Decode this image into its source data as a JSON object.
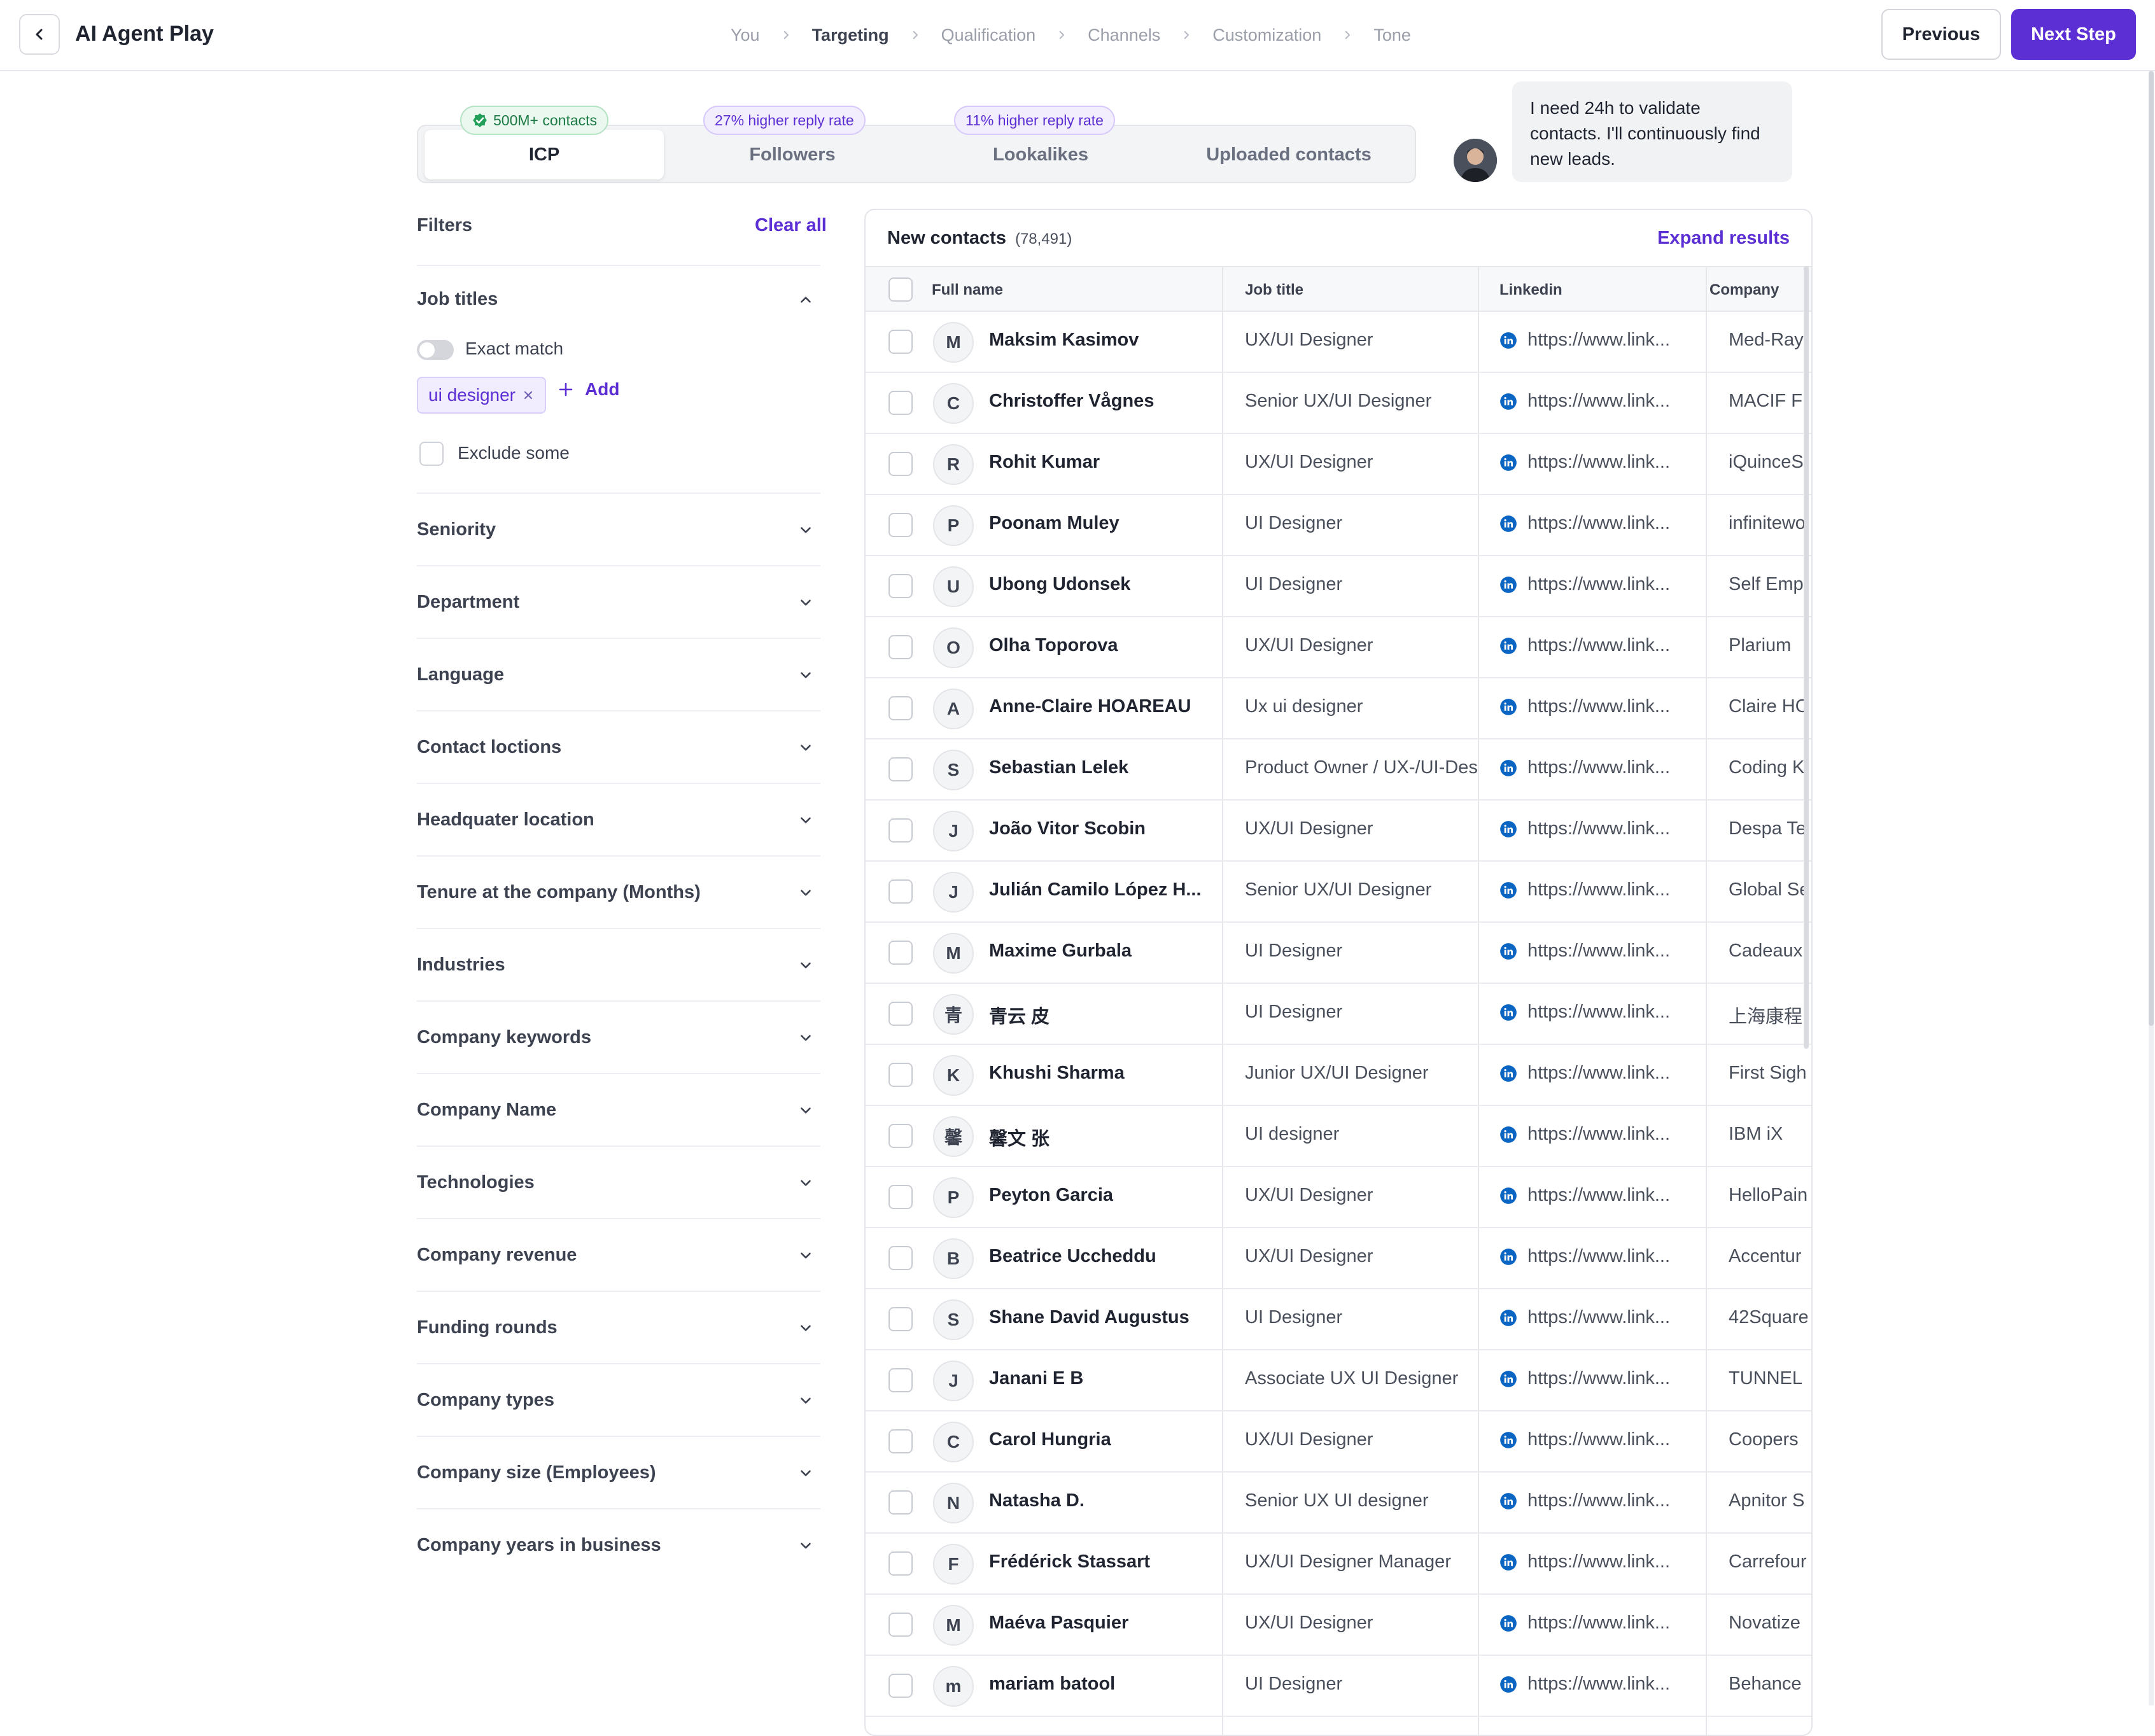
{
  "header": {
    "app_title": "AI Agent Play",
    "steps": [
      "You",
      "Targeting",
      "Qualification",
      "Channels",
      "Customization",
      "Tone"
    ],
    "active_step": "Targeting",
    "previous_label": "Previous",
    "next_label": "Next Step"
  },
  "source_tabs": [
    {
      "label": "ICP",
      "badge": "500M+ contacts",
      "active": true
    },
    {
      "label": "Followers",
      "badge": "27% higher reply rate",
      "active": false
    },
    {
      "label": "Lookalikes",
      "badge": "11% higher reply rate",
      "active": false
    },
    {
      "label": "Uploaded contacts",
      "badge": "",
      "active": false
    }
  ],
  "agent_message": "I need 24h to validate contacts. I'll continuously find new leads.",
  "filters": {
    "title": "Filters",
    "clear_all": "Clear all",
    "job_titles": {
      "label": "Job titles",
      "exact_match_label": "Exact match",
      "exact_match_on": false,
      "tag": "ui designer",
      "add_label": "Add",
      "exclude_label": "Exclude some"
    },
    "sections": [
      "Seniority",
      "Department",
      "Language",
      "Contact loctions",
      "Headquater location",
      "Tenure at the company (Months)",
      "Industries",
      "Company keywords",
      "Company Name",
      "Technologies",
      "Company revenue",
      "Funding rounds",
      "Company types",
      "Company size (Employees)",
      "Company years in business"
    ]
  },
  "results": {
    "title": "New contacts",
    "count": "(78,491)",
    "expand_label": "Expand results",
    "columns": [
      "Full name",
      "Job title",
      "Linkedin",
      "Company"
    ],
    "rows": [
      {
        "initial": "M",
        "name": "Maksim Kasimov",
        "job": "UX/UI Designer",
        "linkedin": "https://www.link...",
        "company": "Med-Ray"
      },
      {
        "initial": "C",
        "name": "Christoffer Vågnes",
        "job": "Senior UX/UI Designer",
        "linkedin": "https://www.link...",
        "company": "MACIF FI"
      },
      {
        "initial": "R",
        "name": "Rohit Kumar",
        "job": "UX/UI Designer",
        "linkedin": "https://www.link...",
        "company": "iQuinceS"
      },
      {
        "initial": "P",
        "name": "Poonam Muley",
        "job": "UI Designer",
        "linkedin": "https://www.link...",
        "company": "infinitewo"
      },
      {
        "initial": "U",
        "name": "Ubong Udonsek",
        "job": "UI Designer",
        "linkedin": "https://www.link...",
        "company": "Self Empl"
      },
      {
        "initial": "O",
        "name": "Olha Toporova",
        "job": "UX/UI Designer",
        "linkedin": "https://www.link...",
        "company": "Plarium"
      },
      {
        "initial": "A",
        "name": "Anne-Claire HOAREAU",
        "job": "Ux ui designer",
        "linkedin": "https://www.link...",
        "company": "Claire HO"
      },
      {
        "initial": "S",
        "name": "Sebastian Lelek",
        "job": "Product Owner / UX-/UI-Des",
        "linkedin": "https://www.link...",
        "company": "Coding K"
      },
      {
        "initial": "J",
        "name": "João Vitor Scobin",
        "job": "UX/UI Designer",
        "linkedin": "https://www.link...",
        "company": "Despa Te"
      },
      {
        "initial": "J",
        "name": "Julián Camilo López H...",
        "job": "Senior UX/UI Designer",
        "linkedin": "https://www.link...",
        "company": "Global Se"
      },
      {
        "initial": "M",
        "name": "Maxime Gurbala",
        "job": "UI Designer",
        "linkedin": "https://www.link...",
        "company": "Cadeaux"
      },
      {
        "initial": "青",
        "name": "青云 皮",
        "job": "UI Designer",
        "linkedin": "https://www.link...",
        "company": "上海康程"
      },
      {
        "initial": "K",
        "name": "Khushi Sharma",
        "job": "Junior UX/UI Designer",
        "linkedin": "https://www.link...",
        "company": "First Sigh"
      },
      {
        "initial": "馨",
        "name": "馨文 张",
        "job": "UI designer",
        "linkedin": "https://www.link...",
        "company": "IBM iX"
      },
      {
        "initial": "P",
        "name": "Peyton Garcia",
        "job": "UX/UI Designer",
        "linkedin": "https://www.link...",
        "company": "HelloPain"
      },
      {
        "initial": "B",
        "name": "Beatrice Uccheddu",
        "job": "UX/UI Designer",
        "linkedin": "https://www.link...",
        "company": "Accentur"
      },
      {
        "initial": "S",
        "name": "Shane David Augustus",
        "job": "UI Designer",
        "linkedin": "https://www.link...",
        "company": "42Square"
      },
      {
        "initial": "J",
        "name": "Janani E B",
        "job": "Associate UX UI Designer",
        "linkedin": "https://www.link...",
        "company": "TUNNEL"
      },
      {
        "initial": "C",
        "name": "Carol Hungria",
        "job": "UX/UI Designer",
        "linkedin": "https://www.link...",
        "company": "Coopers"
      },
      {
        "initial": "N",
        "name": "Natasha D.",
        "job": "Senior UX UI designer",
        "linkedin": "https://www.link...",
        "company": "Apnitor S"
      },
      {
        "initial": "F",
        "name": "Frédérick Stassart",
        "job": "UX/UI Designer Manager",
        "linkedin": "https://www.link...",
        "company": "Carrefour"
      },
      {
        "initial": "M",
        "name": "Maéva Pasquier",
        "job": "UX/UI Designer",
        "linkedin": "https://www.link...",
        "company": "Novatize"
      },
      {
        "initial": "m",
        "name": "mariam batool",
        "job": "UI Designer",
        "linkedin": "https://www.link...",
        "company": "Behance"
      }
    ]
  },
  "colors": {
    "accent": "#5b2fd3",
    "linkedin": "#0a66c2",
    "success": "#1d7a45"
  }
}
